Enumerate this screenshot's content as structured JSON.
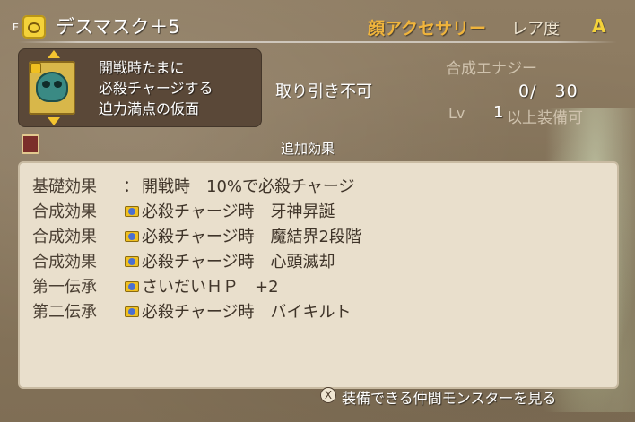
{
  "header": {
    "equip_marker": "E",
    "item_name": "デスマスク＋5",
    "category": "顔アクセサリー",
    "rarity_label": "レア度",
    "rarity_value": "A"
  },
  "item": {
    "description_lines": [
      "開戦時たまに",
      "必殺チャージする",
      "迫力満点の仮面"
    ],
    "trade_status": "取り引き不可",
    "energy_label": "合成エナジー",
    "energy_value": "0/　30",
    "level_label": "Lv",
    "level_value": "1",
    "level_note": "以上装備可"
  },
  "effects": {
    "title": "追加効果",
    "rows": [
      {
        "label": "基礎効果",
        "colon": "：",
        "text": "開戦時　10%で必殺チャージ",
        "icon": "none"
      },
      {
        "label": "合成効果",
        "text": "必殺チャージ時　牙神昇誕",
        "icon": "crown-icon"
      },
      {
        "label": "合成効果",
        "text": "必殺チャージ時　魔結界2段階",
        "icon": "crown-icon"
      },
      {
        "label": "合成効果",
        "text": "必殺チャージ時　心頭滅却",
        "icon": "crown-icon"
      },
      {
        "label": "第一伝承",
        "text": "さいだいＨＰ　+2",
        "icon": "crown-icon"
      },
      {
        "label": "第二伝承",
        "text": "必殺チャージ時　バイキルト",
        "icon": "crown-icon"
      }
    ]
  },
  "footer": {
    "button_glyph": "X",
    "action_label": "装備できる仲間モンスターを見る"
  },
  "colors": {
    "category": "#f0b43c",
    "rarity": "#f4d23a",
    "panel": "#e9dfcc"
  }
}
